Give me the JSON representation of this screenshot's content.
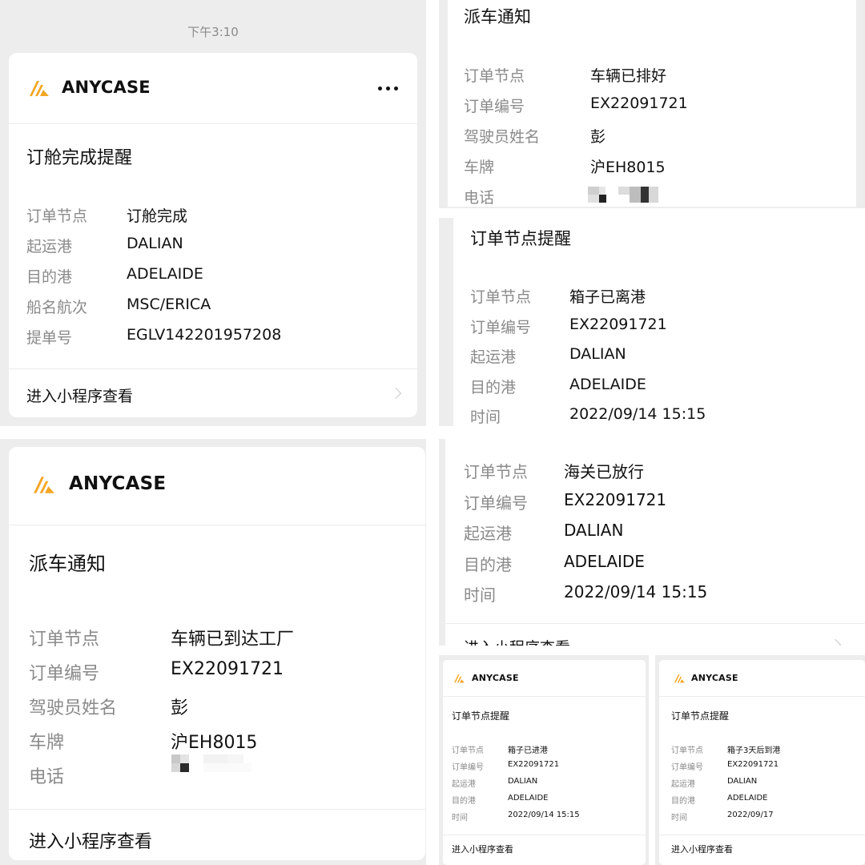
{
  "chat": {
    "status_time": "下午3:10",
    "brand": "ANYCASE",
    "footer_link": "进入小程序查看",
    "more_menu": "more-dots-icon"
  },
  "card_booking": {
    "title": "订舱完成提醒",
    "fields": [
      {
        "label": "订单节点",
        "value": "订舱完成"
      },
      {
        "label": "起运港",
        "value": "DALIAN"
      },
      {
        "label": "目的港",
        "value": "ADELAIDE"
      },
      {
        "label": "船名航次",
        "value": "MSC/ERICA"
      },
      {
        "label": "提单号",
        "value": "EGLV142201957208"
      }
    ]
  },
  "card_dispatch_top": {
    "title": "派车通知",
    "fields": [
      {
        "label": "订单节点",
        "value": "车辆已排好"
      },
      {
        "label": "订单编号",
        "value": "EX22091721"
      },
      {
        "label": "驾驶员姓名",
        "value": "彭"
      },
      {
        "label": "车牌",
        "value": "沪EH8015"
      },
      {
        "label": "电话",
        "value": ""
      }
    ]
  },
  "card_departed": {
    "title": "订单节点提醒",
    "fields": [
      {
        "label": "订单节点",
        "value": "箱子已离港"
      },
      {
        "label": "订单编号",
        "value": "EX22091721"
      },
      {
        "label": "起运港",
        "value": "DALIAN"
      },
      {
        "label": "目的港",
        "value": "ADELAIDE"
      },
      {
        "label": "时间",
        "value": "2022/09/14 15:15"
      }
    ]
  },
  "card_dispatch_factory": {
    "title": "派车通知",
    "fields": [
      {
        "label": "订单节点",
        "value": "车辆已到达工厂"
      },
      {
        "label": "订单编号",
        "value": "EX22091721"
      },
      {
        "label": "驾驶员姓名",
        "value": "彭"
      },
      {
        "label": "车牌",
        "value": "沪EH8015"
      },
      {
        "label": "电话",
        "value": ""
      }
    ]
  },
  "card_customs": {
    "fields": [
      {
        "label": "订单节点",
        "value": "海关已放行"
      },
      {
        "label": "订单编号",
        "value": "EX22091721"
      },
      {
        "label": "起运港",
        "value": "DALIAN"
      },
      {
        "label": "目的港",
        "value": "ADELAIDE"
      },
      {
        "label": "时间",
        "value": "2022/09/14 15:15"
      }
    ]
  },
  "card_in_port": {
    "title": "订单节点提醒",
    "fields": [
      {
        "label": "订单节点",
        "value": "箱子已进港"
      },
      {
        "label": "订单编号",
        "value": "EX22091721"
      },
      {
        "label": "起运港",
        "value": "DALIAN"
      },
      {
        "label": "目的港",
        "value": "ADELAIDE"
      },
      {
        "label": "时间",
        "value": "2022/09/14 15:15"
      }
    ]
  },
  "card_arrival_soon": {
    "title": "订单节点提醒",
    "fields": [
      {
        "label": "订单节点",
        "value": "箱子3天后到港"
      },
      {
        "label": "订单编号",
        "value": "EX22091721"
      },
      {
        "label": "起运港",
        "value": "DALIAN"
      },
      {
        "label": "目的港",
        "value": "ADELAIDE"
      },
      {
        "label": "时间",
        "value": "2022/09/17"
      }
    ]
  },
  "colors": {
    "chat_bg": "#ededed",
    "card_bg": "#ffffff",
    "logo_orange": "#f5a623",
    "label_gray": "#8a8a8a"
  }
}
